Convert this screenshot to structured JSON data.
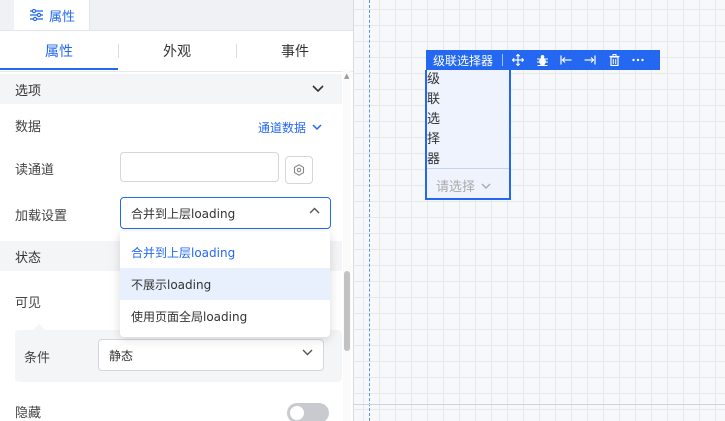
{
  "panel": {
    "tab_label": "属性",
    "subtabs": [
      "属性",
      "外观",
      "事件"
    ]
  },
  "sections": {
    "options": {
      "title": "选项",
      "data_label": "数据",
      "data_value": "通道数据",
      "read_channel_label": "读通道",
      "read_channel_value": "",
      "loading_label": "加载设置",
      "loading_value": "合并到上层loading",
      "loading_options": [
        "合并到上层loading",
        "不展示loading",
        "使用页面全局loading"
      ]
    },
    "state": {
      "title": "状态",
      "visible_label": "可见",
      "condition_label": "条件",
      "condition_value": "静态",
      "hidden_label": "隐藏"
    }
  },
  "canvas": {
    "component_name": "级联选择器",
    "component_label_chars": [
      "级",
      "联",
      "选",
      "择",
      "器"
    ],
    "placeholder": "请选择"
  },
  "colors": {
    "accent": "#2468f2",
    "hover_bg": "#e8f0fe",
    "section_bg": "#f4f5f7"
  }
}
